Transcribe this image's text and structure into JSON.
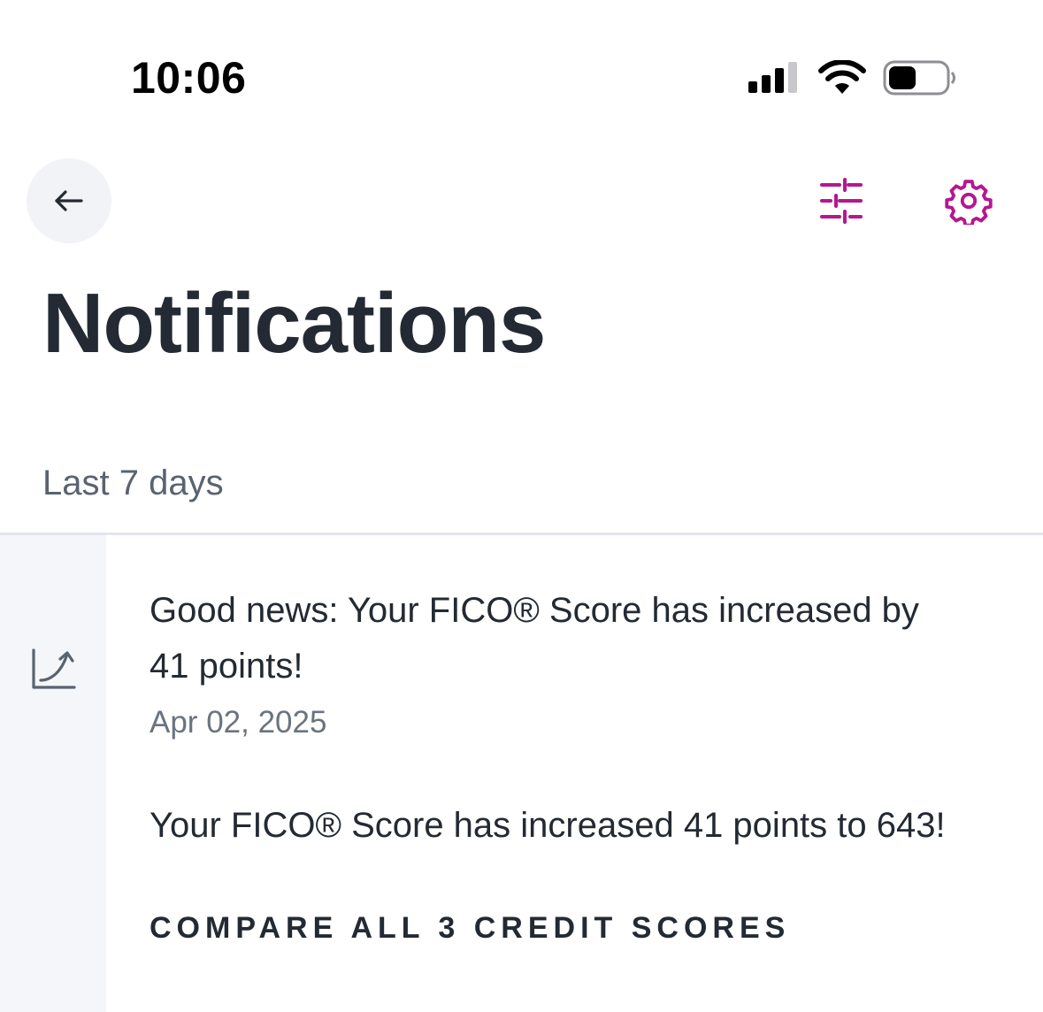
{
  "status_bar": {
    "time": "10:06",
    "icons": [
      "cellular-signal-icon",
      "wifi-icon",
      "battery-icon"
    ]
  },
  "header": {
    "back_icon": "arrow-left-icon",
    "filter_icon": "sliders-icon",
    "settings_icon": "gear-icon",
    "title": "Notifications"
  },
  "colors": {
    "accent": "#b5178f",
    "title_text": "#242a33",
    "muted_text": "#6b7380",
    "rail_background": "#f5f6f9",
    "back_button_background": "#f2f3f6"
  },
  "sections": [
    {
      "header": "Last 7 days",
      "items": [
        {
          "icon": "trending-up-chart-icon",
          "title": "Good news: Your FICO® Score has increased by 41 points!",
          "date": "Apr 02, 2025",
          "body": "Your FICO® Score has increased 41 points to 643!",
          "action_label": "COMPARE ALL 3 CREDIT SCORES"
        }
      ]
    }
  ]
}
